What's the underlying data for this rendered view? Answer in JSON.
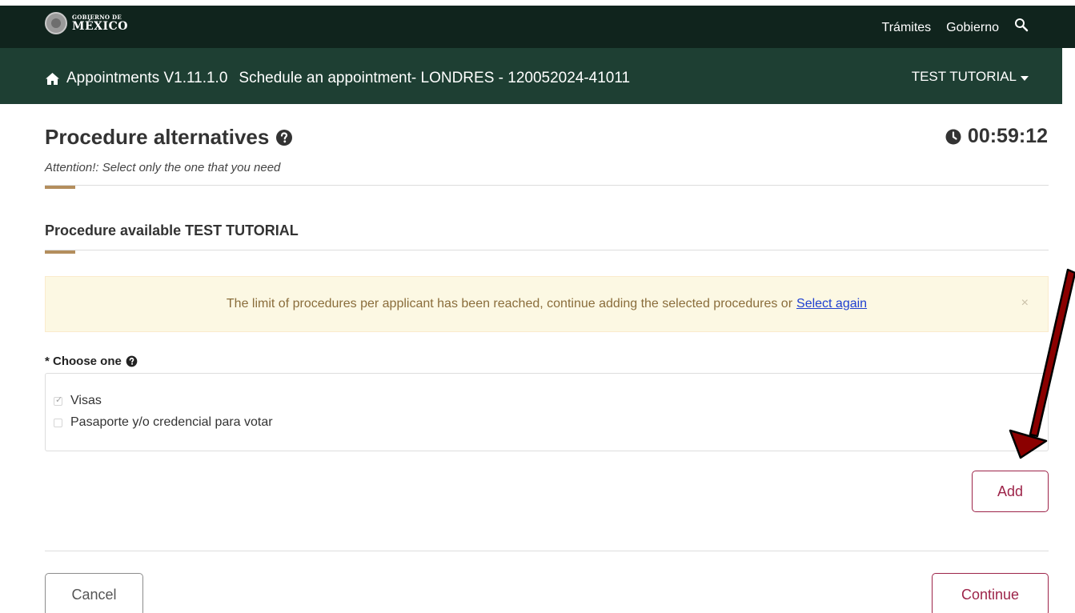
{
  "header": {
    "logo_small": "GOBIERNO DE",
    "logo_big": "MÉXICO",
    "links": [
      "Trámites",
      "Gobierno"
    ],
    "search_icon": "search-icon"
  },
  "nav": {
    "home_icon": "home-icon",
    "app_name": "Appointments V1.11.1.0",
    "breadcrumb": "Schedule an appointment- LONDRES - 120052024-41011",
    "user": "TEST TUTORIAL"
  },
  "page": {
    "title": "Procedure alternatives",
    "timer": "00:59:12",
    "subtitle": "Attention!: Select only the one that you need",
    "section_title": "Procedure available TEST TUTORIAL"
  },
  "alert": {
    "message": "The limit of procedures per applicant has been reached, continue adding the selected procedures or",
    "link_text": "Select again",
    "close": "×"
  },
  "choose": {
    "label": "* Choose one",
    "options": [
      {
        "label": "Visas",
        "checked": true
      },
      {
        "label": "Pasaporte y/o credencial para votar",
        "checked": false
      }
    ]
  },
  "buttons": {
    "add": "Add",
    "cancel": "Cancel",
    "continue": "Continue"
  },
  "colors": {
    "top_bar": "#10241d",
    "nav_bar": "#1e3f33",
    "accent_gold": "#b38e5d",
    "primary_maroon": "#9d2449",
    "alert_bg": "#fcf8e3",
    "annotation_arrow": "#8b0000"
  }
}
